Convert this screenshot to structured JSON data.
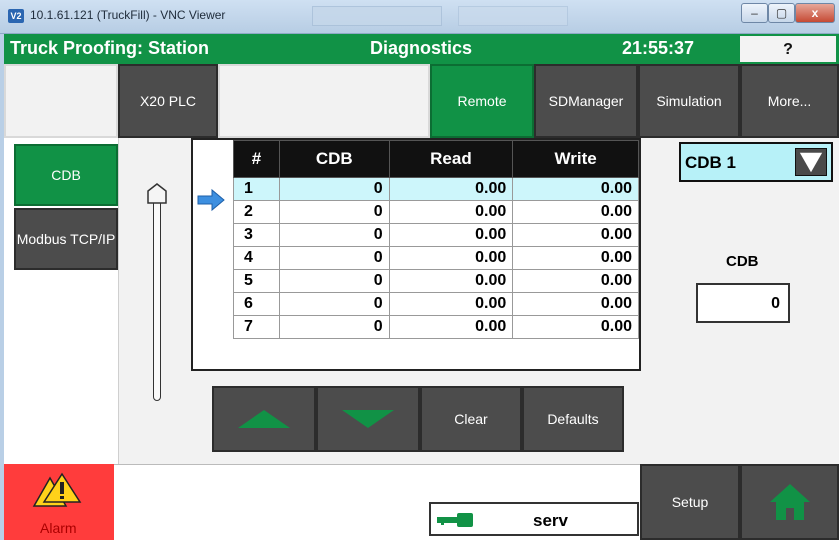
{
  "window": {
    "title": "10.1.61.121 (TruckFill) - VNC Viewer",
    "icon_text": "V2",
    "min": "–",
    "max": "▢",
    "close": "x"
  },
  "header": {
    "station": "Truck Proofing: Station",
    "screen": "Diagnostics",
    "time": "21:55:37",
    "help": "?"
  },
  "tabs": [
    {
      "label": "X20 PLC"
    },
    {
      "label": "Remote"
    },
    {
      "label": "SDManager"
    },
    {
      "label": "Simulation"
    },
    {
      "label": "More..."
    }
  ],
  "side": [
    {
      "label": "CDB"
    },
    {
      "label": "Modbus TCP/IP"
    }
  ],
  "table": {
    "headers": [
      "#",
      "CDB",
      "Read",
      "Write"
    ],
    "rows": [
      [
        "1",
        "0",
        "0.00",
        "0.00"
      ],
      [
        "2",
        "0",
        "0.00",
        "0.00"
      ],
      [
        "3",
        "0",
        "0.00",
        "0.00"
      ],
      [
        "4",
        "0",
        "0.00",
        "0.00"
      ],
      [
        "5",
        "0",
        "0.00",
        "0.00"
      ],
      [
        "6",
        "0",
        "0.00",
        "0.00"
      ],
      [
        "7",
        "0",
        "0.00",
        "0.00"
      ]
    ],
    "selected_row": 1
  },
  "actions": {
    "clear": "Clear",
    "defaults": "Defaults"
  },
  "cdb_select": {
    "value": "CDB 1"
  },
  "cdb_field": {
    "label": "CDB",
    "value": "0"
  },
  "footer": {
    "alarm": "Alarm",
    "status": "serv",
    "setup": "Setup"
  },
  "colors": {
    "green": "#119246",
    "alarm": "#ff3c3c",
    "selected": "#cdf6fb"
  }
}
